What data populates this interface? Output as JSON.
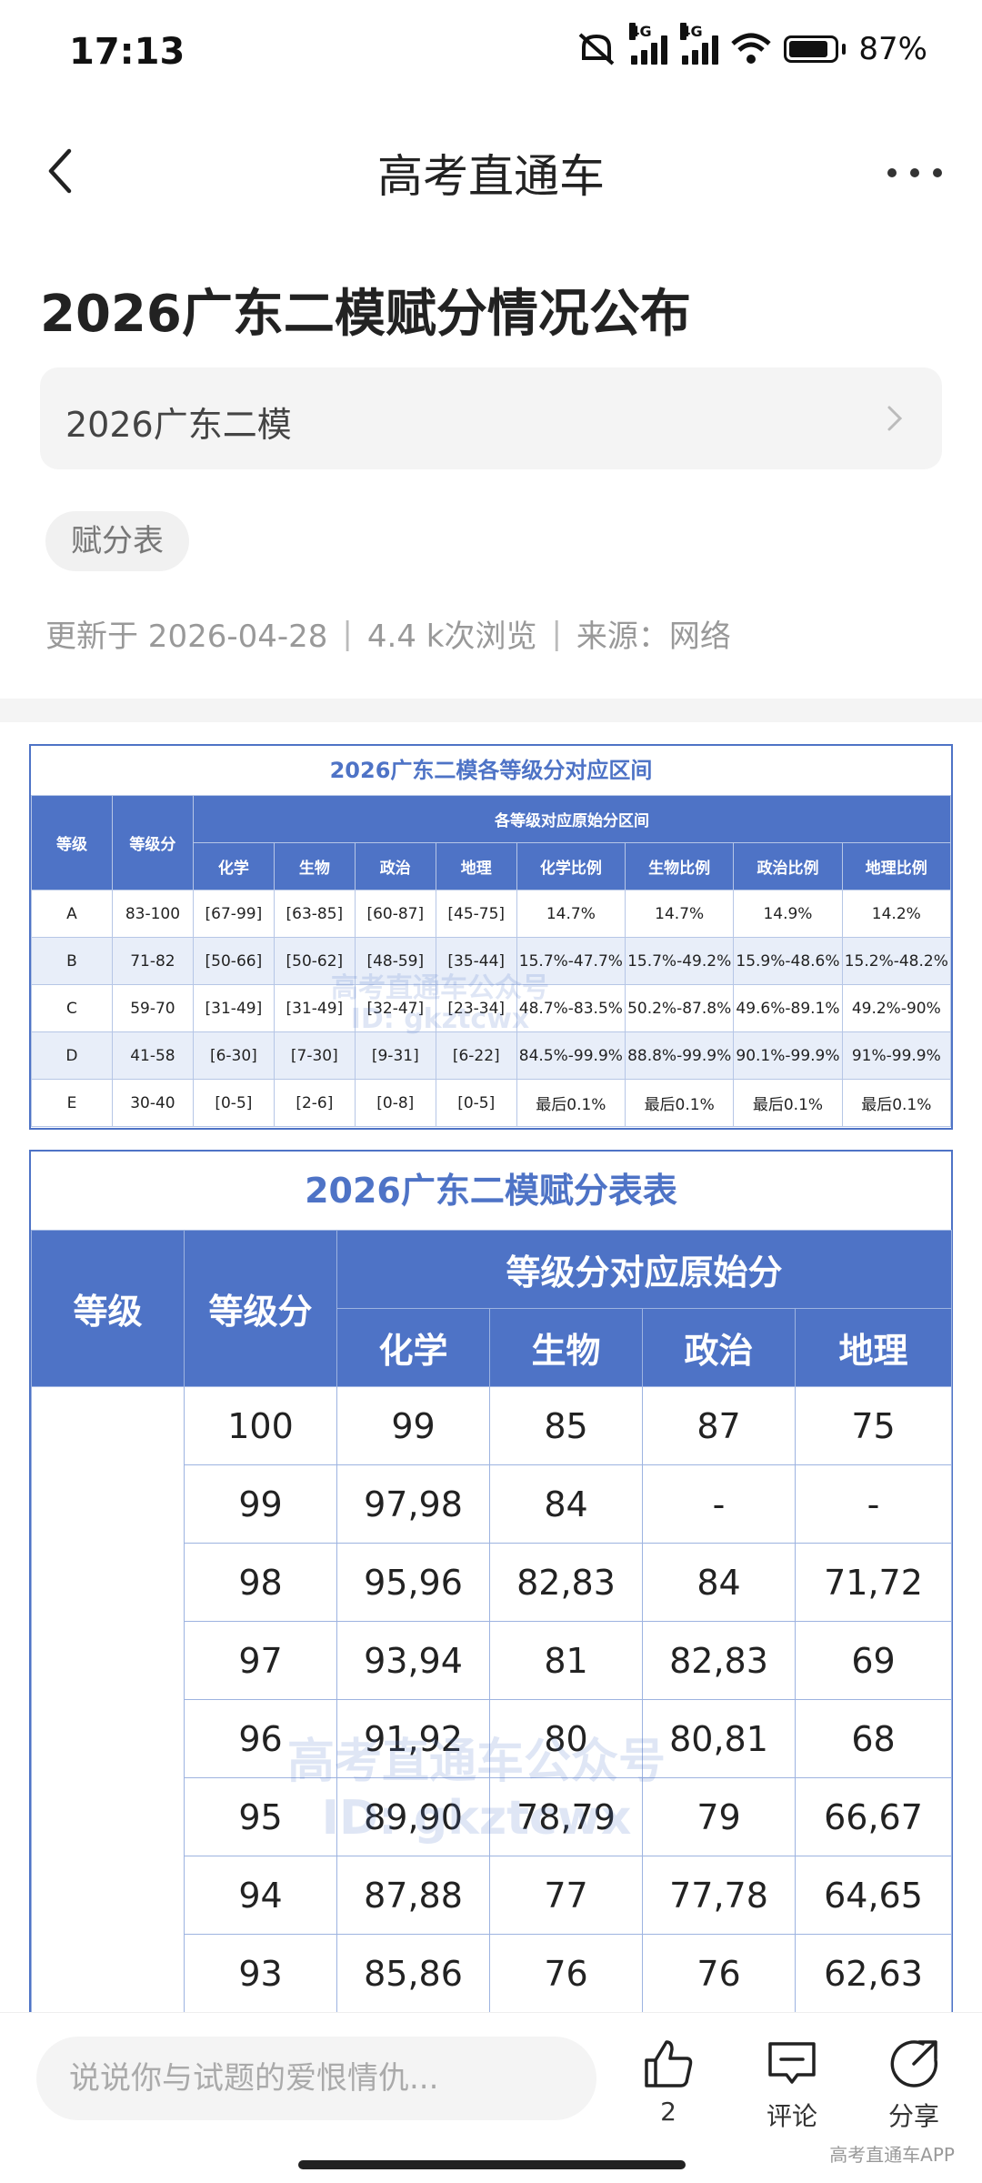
{
  "status_bar": {
    "time": "17:13",
    "net1": "4G",
    "net2": "4G",
    "battery_text": "87%",
    "battery_level": 0.87
  },
  "header": {
    "title": "高考直通车"
  },
  "article": {
    "title": "2026广东二模赋分情况公布",
    "collection": "2026广东二模",
    "tag": "赋分表",
    "meta": {
      "updated": "更新于 2026-04-28",
      "views": "4.4 k次浏览",
      "source": "来源：网络"
    }
  },
  "table1": {
    "title": "2026广东二模各等级分对应区间",
    "headers": {
      "grade": "等级",
      "score": "等级分",
      "group": "各等级对应原始分区间",
      "cols": [
        "化学",
        "生物",
        "政治",
        "地理",
        "化学比例",
        "生物比例",
        "政治比例",
        "地理比例"
      ]
    },
    "rows": [
      [
        "A",
        "83-100",
        "[67-99]",
        "[63-85]",
        "[60-87]",
        "[45-75]",
        "14.7%",
        "14.7%",
        "14.9%",
        "14.2%"
      ],
      [
        "B",
        "71-82",
        "[50-66]",
        "[50-62]",
        "[48-59]",
        "[35-44]",
        "15.7%-47.7%",
        "15.7%-49.2%",
        "15.9%-48.6%",
        "15.2%-48.2%"
      ],
      [
        "C",
        "59-70",
        "[31-49]",
        "[31-49]",
        "[32-47]",
        "[23-34]",
        "48.7%-83.5%",
        "50.2%-87.8%",
        "49.6%-89.1%",
        "49.2%-90%"
      ],
      [
        "D",
        "41-58",
        "[6-30]",
        "[7-30]",
        "[9-31]",
        "[6-22]",
        "84.5%-99.9%",
        "88.8%-99.9%",
        "90.1%-99.9%",
        "91%-99.9%"
      ],
      [
        "E",
        "30-40",
        "[0-5]",
        "[2-6]",
        "[0-8]",
        "[0-5]",
        "最后0.1%",
        "最后0.1%",
        "最后0.1%",
        "最后0.1%"
      ]
    ]
  },
  "table2": {
    "title": "2026广东二模赋分表表",
    "headers": {
      "grade": "等级",
      "score": "等级分",
      "group": "等级分对应原始分",
      "cols": [
        "化学",
        "生物",
        "政治",
        "地理"
      ]
    },
    "rows": [
      [
        "100",
        "99",
        "85",
        "87",
        "75"
      ],
      [
        "99",
        "97,98",
        "84",
        "-",
        "-"
      ],
      [
        "98",
        "95,96",
        "82,83",
        "84",
        "71,72"
      ],
      [
        "97",
        "93,94",
        "81",
        "82,83",
        "69"
      ],
      [
        "96",
        "91,92",
        "80",
        "80,81",
        "68"
      ],
      [
        "95",
        "89,90",
        "78,79",
        "79",
        "66,67"
      ],
      [
        "94",
        "87,88",
        "77",
        "77,78",
        "64,65"
      ],
      [
        "93",
        "85,86",
        "76",
        "76",
        "62,63"
      ]
    ]
  },
  "watermark": {
    "line1": "高考直通车公众号",
    "line2": "ID: gkztcwx"
  },
  "bottom": {
    "comment_placeholder": "说说你与试题的爱恨情仇...",
    "like_count": "2",
    "comment_label": "评论",
    "share_label": "分享",
    "brand": "高考直通车APP"
  }
}
